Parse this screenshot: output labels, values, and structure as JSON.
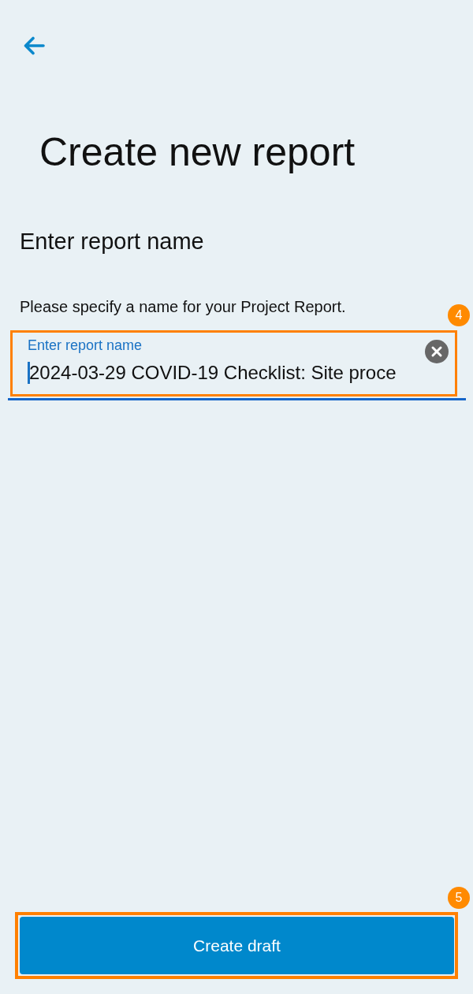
{
  "title": "Create new report",
  "section": {
    "heading": "Enter report name",
    "description": "Please specify a name for your Project Report."
  },
  "name_field": {
    "label": "Enter report name",
    "value": "2024-03-29 COVID-19 Checklist: Site proce",
    "focused": true,
    "annotation": "4"
  },
  "create_button": {
    "label": "Create draft",
    "annotation": "5"
  }
}
